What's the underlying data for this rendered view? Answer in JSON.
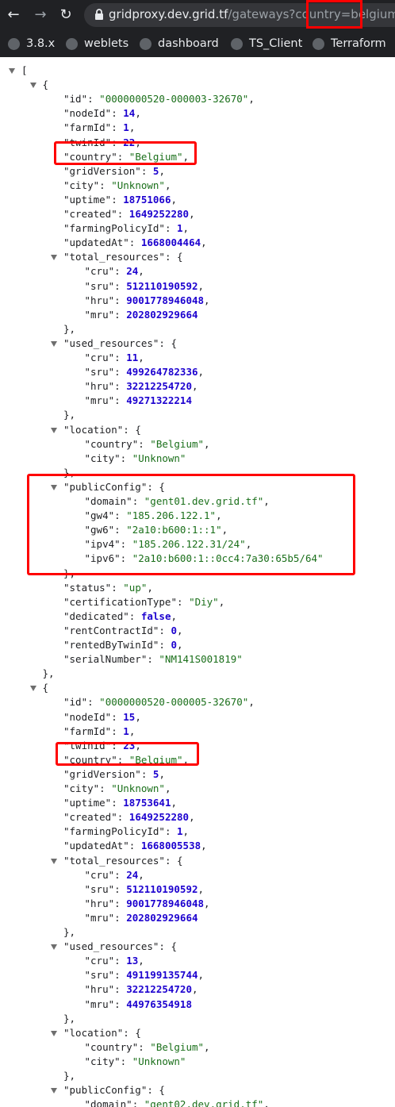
{
  "browser": {
    "url_host": "gridproxy.dev.grid.tf",
    "url_path": "/gateways?country=",
    "url_query_value": "belgium",
    "bookmarks": [
      {
        "label": "3.8.x"
      },
      {
        "label": "weblets"
      },
      {
        "label": "dashboard"
      },
      {
        "label": "TS_Client"
      },
      {
        "label": "Terraform"
      }
    ]
  },
  "json_lines": [
    {
      "indent": 0,
      "tw": true,
      "parts": [
        [
          "p",
          "["
        ]
      ]
    },
    {
      "indent": 1,
      "tw": true,
      "parts": [
        [
          "p",
          "{"
        ]
      ]
    },
    {
      "indent": 2,
      "parts": [
        [
          "key",
          "\"id\""
        ],
        [
          "p",
          ": "
        ],
        [
          "str",
          "\"0000000520-000003-32670\""
        ],
        [
          "p",
          ","
        ]
      ]
    },
    {
      "indent": 2,
      "parts": [
        [
          "key",
          "\"nodeId\""
        ],
        [
          "p",
          ": "
        ],
        [
          "num",
          "14"
        ],
        [
          "p",
          ","
        ]
      ]
    },
    {
      "indent": 2,
      "parts": [
        [
          "key",
          "\"farmId\""
        ],
        [
          "p",
          ": "
        ],
        [
          "num",
          "1"
        ],
        [
          "p",
          ","
        ]
      ]
    },
    {
      "indent": 2,
      "parts": [
        [
          "key",
          "\"twinId\""
        ],
        [
          "p",
          ": "
        ],
        [
          "num",
          "22"
        ],
        [
          "p",
          ","
        ]
      ]
    },
    {
      "indent": 2,
      "parts": [
        [
          "key",
          "\"country\""
        ],
        [
          "p",
          ": "
        ],
        [
          "str",
          "\"Belgium\""
        ],
        [
          "p",
          ","
        ]
      ]
    },
    {
      "indent": 2,
      "parts": [
        [
          "key",
          "\"gridVersion\""
        ],
        [
          "p",
          ": "
        ],
        [
          "num",
          "5"
        ],
        [
          "p",
          ","
        ]
      ]
    },
    {
      "indent": 2,
      "parts": [
        [
          "key",
          "\"city\""
        ],
        [
          "p",
          ": "
        ],
        [
          "str",
          "\"Unknown\""
        ],
        [
          "p",
          ","
        ]
      ]
    },
    {
      "indent": 2,
      "parts": [
        [
          "key",
          "\"uptime\""
        ],
        [
          "p",
          ": "
        ],
        [
          "num",
          "18751066"
        ],
        [
          "p",
          ","
        ]
      ]
    },
    {
      "indent": 2,
      "parts": [
        [
          "key",
          "\"created\""
        ],
        [
          "p",
          ": "
        ],
        [
          "num",
          "1649252280"
        ],
        [
          "p",
          ","
        ]
      ]
    },
    {
      "indent": 2,
      "parts": [
        [
          "key",
          "\"farmingPolicyId\""
        ],
        [
          "p",
          ": "
        ],
        [
          "num",
          "1"
        ],
        [
          "p",
          ","
        ]
      ]
    },
    {
      "indent": 2,
      "parts": [
        [
          "key",
          "\"updatedAt\""
        ],
        [
          "p",
          ": "
        ],
        [
          "num",
          "1668004464"
        ],
        [
          "p",
          ","
        ]
      ]
    },
    {
      "indent": 2,
      "tw": true,
      "parts": [
        [
          "key",
          "\"total_resources\""
        ],
        [
          "p",
          ": {"
        ]
      ]
    },
    {
      "indent": 3,
      "parts": [
        [
          "key",
          "\"cru\""
        ],
        [
          "p",
          ": "
        ],
        [
          "num",
          "24"
        ],
        [
          "p",
          ","
        ]
      ]
    },
    {
      "indent": 3,
      "parts": [
        [
          "key",
          "\"sru\""
        ],
        [
          "p",
          ": "
        ],
        [
          "num",
          "512110190592"
        ],
        [
          "p",
          ","
        ]
      ]
    },
    {
      "indent": 3,
      "parts": [
        [
          "key",
          "\"hru\""
        ],
        [
          "p",
          ": "
        ],
        [
          "num",
          "9001778946048"
        ],
        [
          "p",
          ","
        ]
      ]
    },
    {
      "indent": 3,
      "parts": [
        [
          "key",
          "\"mru\""
        ],
        [
          "p",
          ": "
        ],
        [
          "num",
          "202802929664"
        ]
      ]
    },
    {
      "indent": 2,
      "parts": [
        [
          "p",
          "},"
        ]
      ]
    },
    {
      "indent": 2,
      "tw": true,
      "parts": [
        [
          "key",
          "\"used_resources\""
        ],
        [
          "p",
          ": {"
        ]
      ]
    },
    {
      "indent": 3,
      "parts": [
        [
          "key",
          "\"cru\""
        ],
        [
          "p",
          ": "
        ],
        [
          "num",
          "11"
        ],
        [
          "p",
          ","
        ]
      ]
    },
    {
      "indent": 3,
      "parts": [
        [
          "key",
          "\"sru\""
        ],
        [
          "p",
          ": "
        ],
        [
          "num",
          "499264782336"
        ],
        [
          "p",
          ","
        ]
      ]
    },
    {
      "indent": 3,
      "parts": [
        [
          "key",
          "\"hru\""
        ],
        [
          "p",
          ": "
        ],
        [
          "num",
          "32212254720"
        ],
        [
          "p",
          ","
        ]
      ]
    },
    {
      "indent": 3,
      "parts": [
        [
          "key",
          "\"mru\""
        ],
        [
          "p",
          ": "
        ],
        [
          "num",
          "49271322214"
        ]
      ]
    },
    {
      "indent": 2,
      "parts": [
        [
          "p",
          "},"
        ]
      ]
    },
    {
      "indent": 2,
      "tw": true,
      "parts": [
        [
          "key",
          "\"location\""
        ],
        [
          "p",
          ": {"
        ]
      ]
    },
    {
      "indent": 3,
      "parts": [
        [
          "key",
          "\"country\""
        ],
        [
          "p",
          ": "
        ],
        [
          "str",
          "\"Belgium\""
        ],
        [
          "p",
          ","
        ]
      ]
    },
    {
      "indent": 3,
      "parts": [
        [
          "key",
          "\"city\""
        ],
        [
          "p",
          ": "
        ],
        [
          "str",
          "\"Unknown\""
        ]
      ]
    },
    {
      "indent": 2,
      "parts": [
        [
          "p",
          "},"
        ]
      ]
    },
    {
      "indent": 2,
      "tw": true,
      "parts": [
        [
          "key",
          "\"publicConfig\""
        ],
        [
          "p",
          ": {"
        ]
      ]
    },
    {
      "indent": 3,
      "parts": [
        [
          "key",
          "\"domain\""
        ],
        [
          "p",
          ": "
        ],
        [
          "str",
          "\"gent01.dev.grid.tf\""
        ],
        [
          "p",
          ","
        ]
      ]
    },
    {
      "indent": 3,
      "parts": [
        [
          "key",
          "\"gw4\""
        ],
        [
          "p",
          ": "
        ],
        [
          "str",
          "\"185.206.122.1\""
        ],
        [
          "p",
          ","
        ]
      ]
    },
    {
      "indent": 3,
      "parts": [
        [
          "key",
          "\"gw6\""
        ],
        [
          "p",
          ": "
        ],
        [
          "str",
          "\"2a10:b600:1::1\""
        ],
        [
          "p",
          ","
        ]
      ]
    },
    {
      "indent": 3,
      "parts": [
        [
          "key",
          "\"ipv4\""
        ],
        [
          "p",
          ": "
        ],
        [
          "str",
          "\"185.206.122.31/24\""
        ],
        [
          "p",
          ","
        ]
      ]
    },
    {
      "indent": 3,
      "parts": [
        [
          "key",
          "\"ipv6\""
        ],
        [
          "p",
          ": "
        ],
        [
          "str",
          "\"2a10:b600:1::0cc4:7a30:65b5/64\""
        ]
      ]
    },
    {
      "indent": 2,
      "parts": [
        [
          "p",
          "},"
        ]
      ]
    },
    {
      "indent": 2,
      "parts": [
        [
          "key",
          "\"status\""
        ],
        [
          "p",
          ": "
        ],
        [
          "str",
          "\"up\""
        ],
        [
          "p",
          ","
        ]
      ]
    },
    {
      "indent": 2,
      "parts": [
        [
          "key",
          "\"certificationType\""
        ],
        [
          "p",
          ": "
        ],
        [
          "str",
          "\"Diy\""
        ],
        [
          "p",
          ","
        ]
      ]
    },
    {
      "indent": 2,
      "parts": [
        [
          "key",
          "\"dedicated\""
        ],
        [
          "p",
          ": "
        ],
        [
          "bool",
          "false"
        ],
        [
          "p",
          ","
        ]
      ]
    },
    {
      "indent": 2,
      "parts": [
        [
          "key",
          "\"rentContractId\""
        ],
        [
          "p",
          ": "
        ],
        [
          "num",
          "0"
        ],
        [
          "p",
          ","
        ]
      ]
    },
    {
      "indent": 2,
      "parts": [
        [
          "key",
          "\"rentedByTwinId\""
        ],
        [
          "p",
          ": "
        ],
        [
          "num",
          "0"
        ],
        [
          "p",
          ","
        ]
      ]
    },
    {
      "indent": 2,
      "parts": [
        [
          "key",
          "\"serialNumber\""
        ],
        [
          "p",
          ": "
        ],
        [
          "str",
          "\"NM141S001819\""
        ]
      ]
    },
    {
      "indent": 1,
      "parts": [
        [
          "p",
          "},"
        ]
      ]
    },
    {
      "indent": 1,
      "tw": true,
      "parts": [
        [
          "p",
          "{"
        ]
      ]
    },
    {
      "indent": 2,
      "parts": [
        [
          "key",
          "\"id\""
        ],
        [
          "p",
          ": "
        ],
        [
          "str",
          "\"0000000520-000005-32670\""
        ],
        [
          "p",
          ","
        ]
      ]
    },
    {
      "indent": 2,
      "parts": [
        [
          "key",
          "\"nodeId\""
        ],
        [
          "p",
          ": "
        ],
        [
          "num",
          "15"
        ],
        [
          "p",
          ","
        ]
      ]
    },
    {
      "indent": 2,
      "parts": [
        [
          "key",
          "\"farmId\""
        ],
        [
          "p",
          ": "
        ],
        [
          "num",
          "1"
        ],
        [
          "p",
          ","
        ]
      ]
    },
    {
      "indent": 2,
      "parts": [
        [
          "key",
          "\"twinId\""
        ],
        [
          "p",
          ": "
        ],
        [
          "num",
          "23"
        ],
        [
          "p",
          ","
        ]
      ]
    },
    {
      "indent": 2,
      "parts": [
        [
          "key",
          "\"country\""
        ],
        [
          "p",
          ": "
        ],
        [
          "str",
          "\"Belgium\""
        ],
        [
          "p",
          ","
        ]
      ]
    },
    {
      "indent": 2,
      "parts": [
        [
          "key",
          "\"gridVersion\""
        ],
        [
          "p",
          ": "
        ],
        [
          "num",
          "5"
        ],
        [
          "p",
          ","
        ]
      ]
    },
    {
      "indent": 2,
      "parts": [
        [
          "key",
          "\"city\""
        ],
        [
          "p",
          ": "
        ],
        [
          "str",
          "\"Unknown\""
        ],
        [
          "p",
          ","
        ]
      ]
    },
    {
      "indent": 2,
      "parts": [
        [
          "key",
          "\"uptime\""
        ],
        [
          "p",
          ": "
        ],
        [
          "num",
          "18753641"
        ],
        [
          "p",
          ","
        ]
      ]
    },
    {
      "indent": 2,
      "parts": [
        [
          "key",
          "\"created\""
        ],
        [
          "p",
          ": "
        ],
        [
          "num",
          "1649252280"
        ],
        [
          "p",
          ","
        ]
      ]
    },
    {
      "indent": 2,
      "parts": [
        [
          "key",
          "\"farmingPolicyId\""
        ],
        [
          "p",
          ": "
        ],
        [
          "num",
          "1"
        ],
        [
          "p",
          ","
        ]
      ]
    },
    {
      "indent": 2,
      "parts": [
        [
          "key",
          "\"updatedAt\""
        ],
        [
          "p",
          ": "
        ],
        [
          "num",
          "1668005538"
        ],
        [
          "p",
          ","
        ]
      ]
    },
    {
      "indent": 2,
      "tw": true,
      "parts": [
        [
          "key",
          "\"total_resources\""
        ],
        [
          "p",
          ": {"
        ]
      ]
    },
    {
      "indent": 3,
      "parts": [
        [
          "key",
          "\"cru\""
        ],
        [
          "p",
          ": "
        ],
        [
          "num",
          "24"
        ],
        [
          "p",
          ","
        ]
      ]
    },
    {
      "indent": 3,
      "parts": [
        [
          "key",
          "\"sru\""
        ],
        [
          "p",
          ": "
        ],
        [
          "num",
          "512110190592"
        ],
        [
          "p",
          ","
        ]
      ]
    },
    {
      "indent": 3,
      "parts": [
        [
          "key",
          "\"hru\""
        ],
        [
          "p",
          ": "
        ],
        [
          "num",
          "9001778946048"
        ],
        [
          "p",
          ","
        ]
      ]
    },
    {
      "indent": 3,
      "parts": [
        [
          "key",
          "\"mru\""
        ],
        [
          "p",
          ": "
        ],
        [
          "num",
          "202802929664"
        ]
      ]
    },
    {
      "indent": 2,
      "parts": [
        [
          "p",
          "},"
        ]
      ]
    },
    {
      "indent": 2,
      "tw": true,
      "parts": [
        [
          "key",
          "\"used_resources\""
        ],
        [
          "p",
          ": {"
        ]
      ]
    },
    {
      "indent": 3,
      "parts": [
        [
          "key",
          "\"cru\""
        ],
        [
          "p",
          ": "
        ],
        [
          "num",
          "13"
        ],
        [
          "p",
          ","
        ]
      ]
    },
    {
      "indent": 3,
      "parts": [
        [
          "key",
          "\"sru\""
        ],
        [
          "p",
          ": "
        ],
        [
          "num",
          "491199135744"
        ],
        [
          "p",
          ","
        ]
      ]
    },
    {
      "indent": 3,
      "parts": [
        [
          "key",
          "\"hru\""
        ],
        [
          "p",
          ": "
        ],
        [
          "num",
          "32212254720"
        ],
        [
          "p",
          ","
        ]
      ]
    },
    {
      "indent": 3,
      "parts": [
        [
          "key",
          "\"mru\""
        ],
        [
          "p",
          ": "
        ],
        [
          "num",
          "44976354918"
        ]
      ]
    },
    {
      "indent": 2,
      "parts": [
        [
          "p",
          "},"
        ]
      ]
    },
    {
      "indent": 2,
      "tw": true,
      "parts": [
        [
          "key",
          "\"location\""
        ],
        [
          "p",
          ": {"
        ]
      ]
    },
    {
      "indent": 3,
      "parts": [
        [
          "key",
          "\"country\""
        ],
        [
          "p",
          ": "
        ],
        [
          "str",
          "\"Belgium\""
        ],
        [
          "p",
          ","
        ]
      ]
    },
    {
      "indent": 3,
      "parts": [
        [
          "key",
          "\"city\""
        ],
        [
          "p",
          ": "
        ],
        [
          "str",
          "\"Unknown\""
        ]
      ]
    },
    {
      "indent": 2,
      "parts": [
        [
          "p",
          "},"
        ]
      ]
    },
    {
      "indent": 2,
      "tw": true,
      "parts": [
        [
          "key",
          "\"publicConfig\""
        ],
        [
          "p",
          ": {"
        ]
      ]
    },
    {
      "indent": 3,
      "parts": [
        [
          "key",
          "\"domain\""
        ],
        [
          "p",
          ": "
        ],
        [
          "str",
          "\"gent02.dev.grid.tf\""
        ],
        [
          "p",
          ","
        ]
      ]
    }
  ]
}
